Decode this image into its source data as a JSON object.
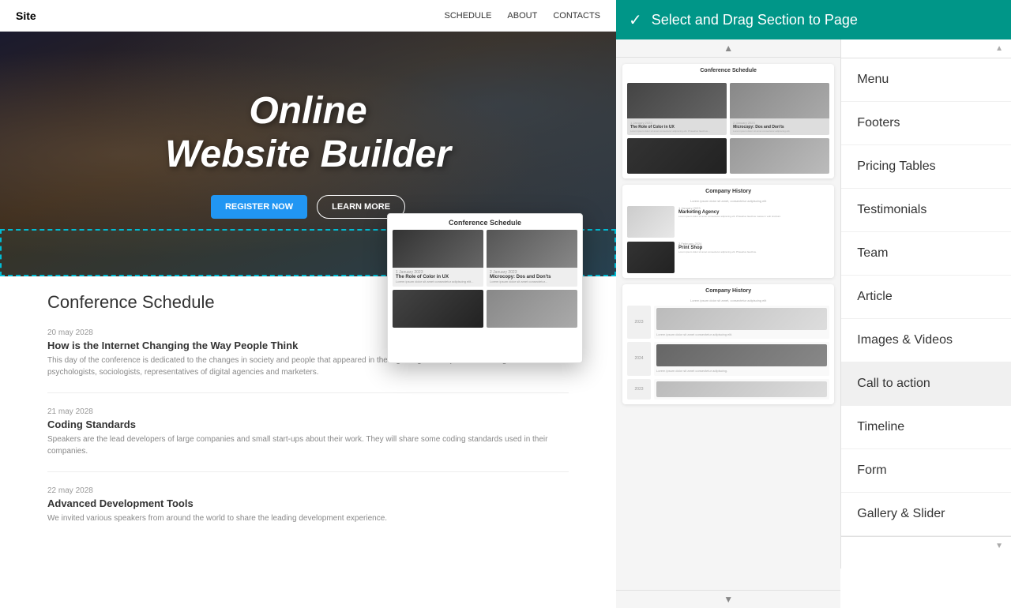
{
  "topbar": {
    "check_icon": "✓",
    "title": "Select and  Drag Section to  Page"
  },
  "site_header": {
    "logo": "Site",
    "nav": [
      "SCHEDULE",
      "ABOUT",
      "CONTACTS"
    ]
  },
  "hero": {
    "title_line1": "Online",
    "title_line2": "Website Builder",
    "btn_register": "REGISTER NOW",
    "btn_learn": "LEARN MORE"
  },
  "dragged_card": {
    "title": "Conference Schedule",
    "items": [
      {
        "date": "1 January 2023",
        "heading": "The Role of Color in UX",
        "body": "Lorem ipsum dolor sit amet consectetur adipiscing elit. Phasellus faucibus massa in velit tincidunt.",
        "img_class": "dark"
      },
      {
        "date": "2 January 2023",
        "heading": "Microcopy: Dos and Don'ts",
        "body": "Lorem ipsum dolor sit amet consectetur adipiscing elit. Phasellus faucibus.",
        "img_class": "lighter"
      }
    ]
  },
  "conference_section": {
    "title": "Conference Schedule",
    "items": [
      {
        "date": "20 may 2028",
        "title": "How is the Internet Changing the Way People Think",
        "desc": "This day of the conference is dedicated to the changes in society and people that appeared in the digital age. The speakers are cognitive psychologists, sociologists, representatives of digital agencies and marketers."
      },
      {
        "date": "21 may 2028",
        "title": "Coding Standards",
        "desc": "Speakers are the lead developers of large companies and small start-ups about their work. They will share some coding standards used in their companies."
      },
      {
        "date": "22 may 2028",
        "title": "Advanced Development Tools",
        "desc": "We invited various speakers from around the world to share the leading development experience."
      }
    ]
  },
  "thumb_cards": [
    {
      "id": "schedule1",
      "title": "Conference Schedule"
    },
    {
      "id": "history1",
      "title": "Company History"
    },
    {
      "id": "history2",
      "title": "Company History"
    }
  ],
  "labels": [
    {
      "id": "menu",
      "label": "Menu"
    },
    {
      "id": "footers",
      "label": "Footers"
    },
    {
      "id": "pricing-tables",
      "label": "Pricing Tables"
    },
    {
      "id": "testimonials",
      "label": "Testimonials"
    },
    {
      "id": "team",
      "label": "Team"
    },
    {
      "id": "article",
      "label": "Article"
    },
    {
      "id": "images-videos",
      "label": "Images & Videos"
    },
    {
      "id": "call-to-action",
      "label": "Call to action"
    },
    {
      "id": "timeline",
      "label": "Timeline"
    },
    {
      "id": "form",
      "label": "Form"
    },
    {
      "id": "gallery-slider",
      "label": "Gallery & Slider"
    }
  ]
}
